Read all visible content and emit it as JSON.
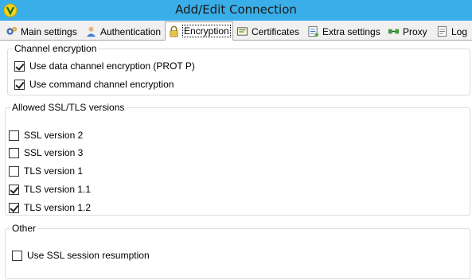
{
  "window": {
    "title": "Add/Edit Connection",
    "accent_color": "#3aaee8"
  },
  "tabs": [
    {
      "label": "Main settings",
      "icon": "gear-icon"
    },
    {
      "label": "Authentication",
      "icon": "user-icon"
    },
    {
      "label": "Encryption",
      "icon": "lock-icon",
      "active": true
    },
    {
      "label": "Certificates",
      "icon": "certificate-icon"
    },
    {
      "label": "Extra settings",
      "icon": "settings-list-icon"
    },
    {
      "label": "Proxy",
      "icon": "proxy-icon"
    },
    {
      "label": "Log",
      "icon": "log-icon"
    }
  ],
  "channel_encryption": {
    "title": "Channel encryption",
    "options": [
      {
        "label": "Use data channel encryption (PROT P)",
        "checked": true
      },
      {
        "label": "Use command channel encryption",
        "checked": true
      }
    ]
  },
  "ssl_versions": {
    "title": "Allowed SSL/TLS versions",
    "options": [
      {
        "label": "SSL version 2",
        "checked": false
      },
      {
        "label": "SSL version 3",
        "checked": false
      },
      {
        "label": "TLS version 1",
        "checked": false
      },
      {
        "label": "TLS version 1.1",
        "checked": true
      },
      {
        "label": "TLS version 1.2",
        "checked": true
      }
    ]
  },
  "other": {
    "title": "Other",
    "options": [
      {
        "label": "Use SSL session resumption",
        "checked": false
      }
    ]
  }
}
